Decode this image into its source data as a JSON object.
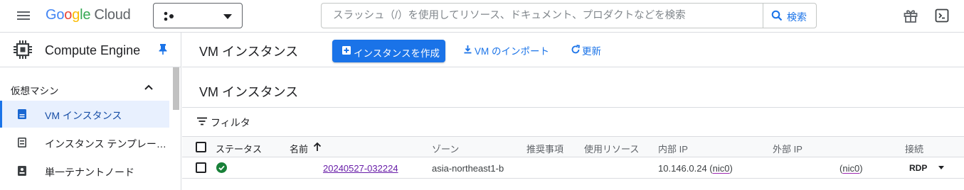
{
  "topbar": {
    "logo": {
      "g1": "Go",
      "g2": "o",
      "g3": "g",
      "g4": "le",
      "cloud": "Cloud"
    },
    "search": {
      "placeholder": "スラッシュ（/）を使用してリソース、ドキュメント、プロダクトなどを検索",
      "button_label": "検索"
    },
    "icons": [
      "menu-icon",
      "project-icon",
      "gift-icon",
      "terminal-icon"
    ]
  },
  "sidebar": {
    "product_title": "Compute Engine",
    "section_label": "仮想マシン",
    "items": [
      {
        "label": "VM インスタンス",
        "icon": "vm-icon",
        "active": true
      },
      {
        "label": "インスタンス テンプレー…",
        "icon": "template-icon",
        "active": false
      },
      {
        "label": "単一テナントノード",
        "icon": "node-icon",
        "active": false
      }
    ]
  },
  "main": {
    "page_title": "VM インスタンス",
    "create_label": "インスタンスを作成",
    "import_label": "VM のインポート",
    "refresh_label": "更新",
    "section_title": "VM インスタンス",
    "filter_label": "フィルタ"
  },
  "table": {
    "headers": {
      "status": "ステータス",
      "name": "名前",
      "zone": "ゾーン",
      "recommendation": "推奨事項",
      "in_use_by": "使用リソース",
      "internal_ip": "内部 IP",
      "external_ip": "外部 IP",
      "connect": "接続"
    },
    "rows": [
      {
        "status": "running",
        "name": "20240527-032224",
        "zone": "asia-northeast1-b",
        "recommendation": "",
        "in_use_by": "",
        "internal_ip": "10.146.0.24",
        "internal_nic": "nic0",
        "external_nic": "nic0",
        "connect": "RDP"
      }
    ]
  },
  "colors": {
    "accent": "#1a73e8",
    "status_ok": "#188038",
    "active_bg": "#e8f0fe"
  }
}
